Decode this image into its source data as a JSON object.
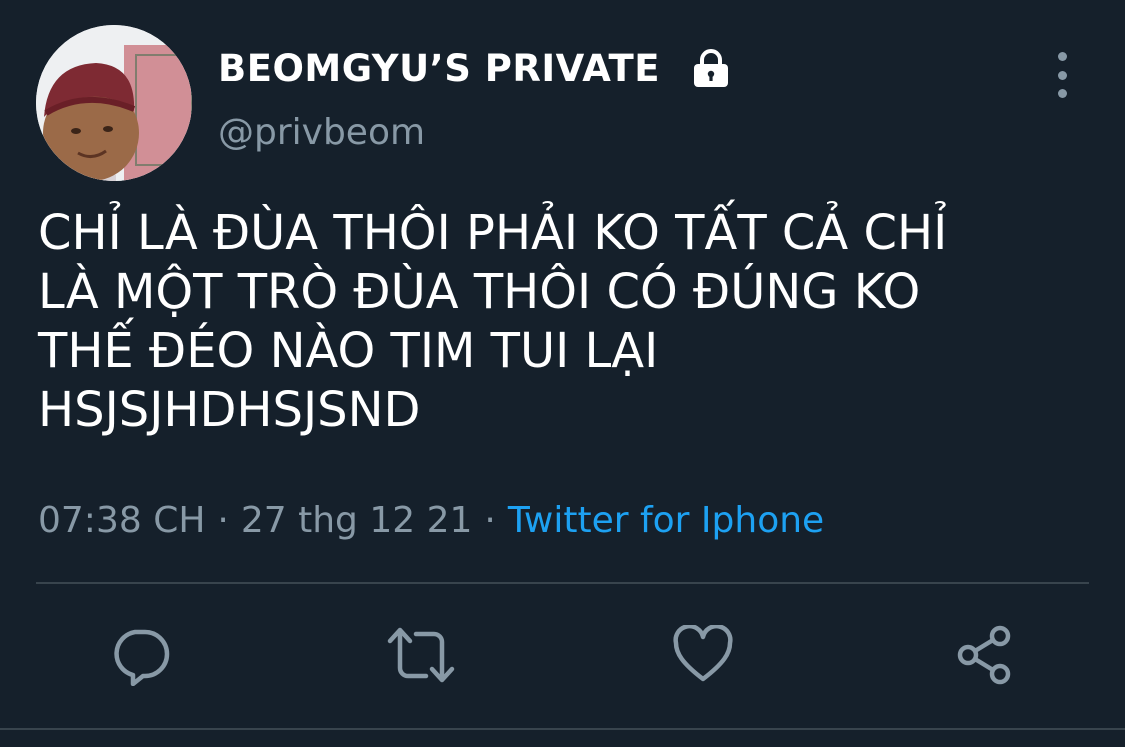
{
  "user": {
    "display_name": "BEOMGYU’S PRIVATE",
    "handle": "@privbeom",
    "protected_icon": "lock-icon",
    "avatar_icon": "avatar-photo"
  },
  "tweet": {
    "text": "CHỈ LÀ ĐÙA THÔI PHẢI KO TẤT CẢ CHỈ\nLÀ MỘT TRÒ ĐÙA THÔI CÓ ĐÚNG KO\nTHẾ ĐÉO NÀO TIM TUI LẠI\nHSJSJHDHSJSND",
    "time": "07:38 CH",
    "date": "27 thg 12 21",
    "separator": "·",
    "source": "Twitter for Iphone"
  },
  "menu": {
    "more_icon": "more-vertical-icon"
  },
  "actions": [
    {
      "name": "reply",
      "icon": "reply-icon"
    },
    {
      "name": "retweet",
      "icon": "retweet-icon"
    },
    {
      "name": "like",
      "icon": "heart-icon"
    },
    {
      "name": "share",
      "icon": "share-icon"
    }
  ],
  "colors": {
    "background": "#15202b",
    "text_primary": "#ffffff",
    "text_secondary": "#8899a6",
    "link": "#1da1f2",
    "divider": "#38444d"
  }
}
